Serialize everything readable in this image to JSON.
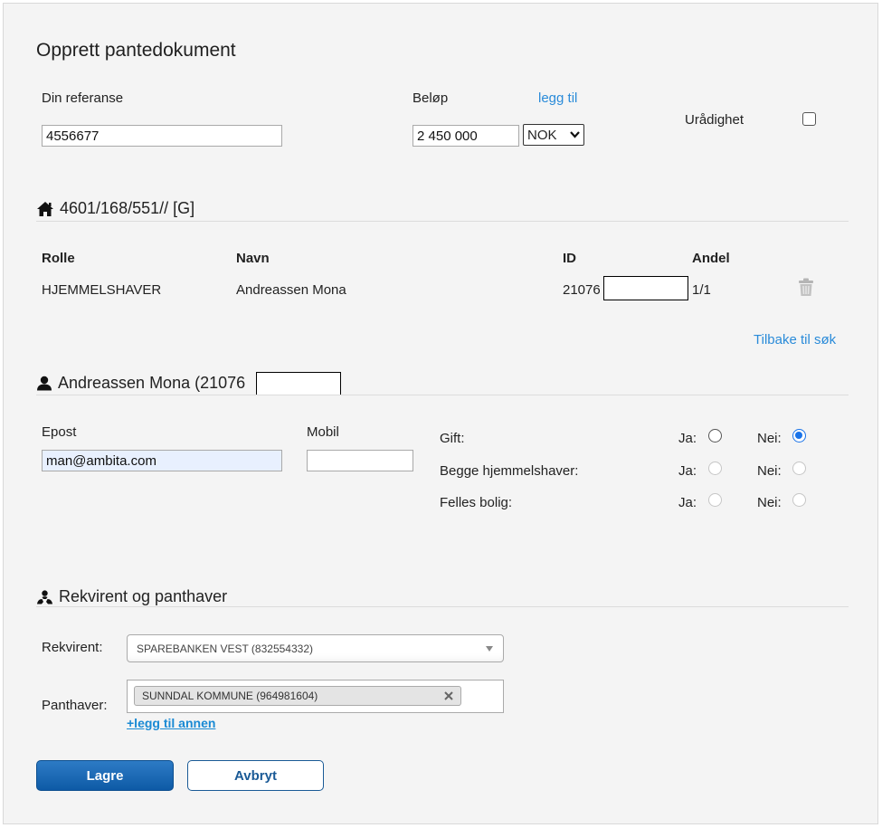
{
  "page_title": "Opprett pantedokument",
  "reference": {
    "label": "Din referanse",
    "value": "4556677"
  },
  "amount": {
    "label": "Beløp",
    "add_link": "legg til",
    "value": "2 450 000",
    "currency": "NOK"
  },
  "uradighet": {
    "label": "Urådighet",
    "checked": false
  },
  "property": {
    "heading": "4601/168/551// [G]",
    "columns": [
      "Rolle",
      "Navn",
      "ID",
      "Andel"
    ],
    "rows": [
      {
        "role": "HJEMMELSHAVER",
        "name": "Andreassen Mona",
        "id": "21076",
        "share": "1/1"
      }
    ],
    "back_link": "Tilbake til søk"
  },
  "person": {
    "heading": "Andreassen Mona (21076",
    "email_label": "Epost",
    "email_value": "man@ambita.com",
    "mobile_label": "Mobil",
    "mobile_value": "",
    "questions": [
      {
        "label": "Gift:",
        "yes": "Ja:",
        "no": "Nei:",
        "selected": "no"
      },
      {
        "label": "Begge hjemmelshaver:",
        "yes": "Ja:",
        "no": "Nei:",
        "selected": null
      },
      {
        "label": "Felles bolig:",
        "yes": "Ja:",
        "no": "Nei:",
        "selected": null
      }
    ]
  },
  "parties": {
    "heading": "Rekvirent og panthaver",
    "rekvirent_label": "Rekvirent:",
    "rekvirent_value": "SPAREBANKEN VEST (832554332)",
    "panthaver_label": "Panthaver:",
    "panthaver_tag": "SUNNDAL KOMMUNE (964981604)",
    "add_other": "+legg til annen"
  },
  "actions": {
    "save": "Lagre",
    "cancel": "Avbryt"
  },
  "colors": {
    "link": "#2a8bd9",
    "primary": "#0e5aa6",
    "radio_selected": "#1a73e8"
  }
}
